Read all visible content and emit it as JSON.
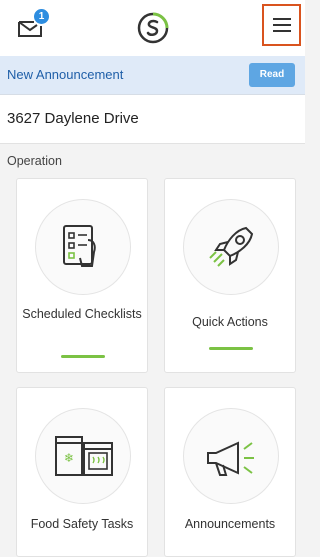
{
  "header": {
    "mail_badge_count": "1",
    "icons": [
      "mail-icon",
      "logo-icon",
      "hamburger-menu-icon"
    ],
    "accent_color": "#7bc244"
  },
  "banner": {
    "title": "New Announcement",
    "read_label": "Read"
  },
  "location": {
    "address": "3627 Daylene Drive"
  },
  "section": {
    "title": "Operation",
    "cards": [
      {
        "label": "Scheduled Checklists",
        "icon": "checklist-icon",
        "selected": true
      },
      {
        "label": "Quick Actions",
        "icon": "rocket-icon",
        "selected": true
      },
      {
        "label": "Food Safety Tasks",
        "icon": "fridge-oven-icon",
        "selected": false
      },
      {
        "label": "Announcements",
        "icon": "megaphone-icon",
        "selected": false
      }
    ]
  }
}
